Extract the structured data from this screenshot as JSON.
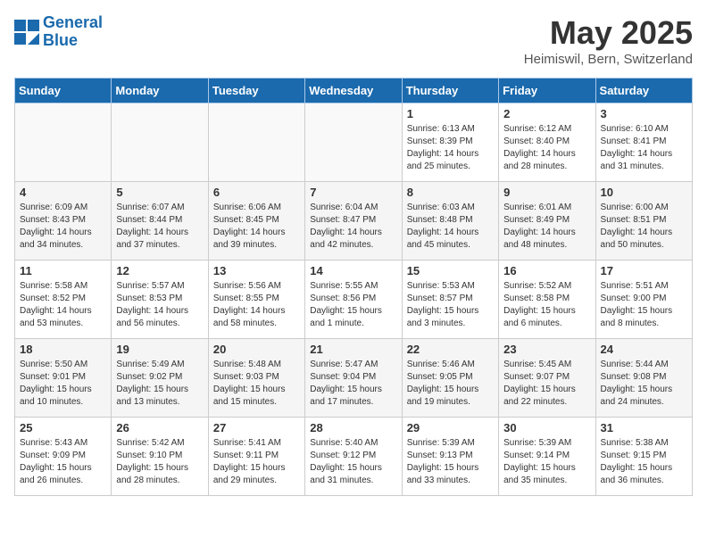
{
  "header": {
    "logo_line1": "General",
    "logo_line2": "Blue",
    "month_year": "May 2025",
    "location": "Heimiswil, Bern, Switzerland"
  },
  "weekdays": [
    "Sunday",
    "Monday",
    "Tuesday",
    "Wednesday",
    "Thursday",
    "Friday",
    "Saturday"
  ],
  "weeks": [
    [
      {
        "day": "",
        "info": ""
      },
      {
        "day": "",
        "info": ""
      },
      {
        "day": "",
        "info": ""
      },
      {
        "day": "",
        "info": ""
      },
      {
        "day": "1",
        "info": "Sunrise: 6:13 AM\nSunset: 8:39 PM\nDaylight: 14 hours\nand 25 minutes."
      },
      {
        "day": "2",
        "info": "Sunrise: 6:12 AM\nSunset: 8:40 PM\nDaylight: 14 hours\nand 28 minutes."
      },
      {
        "day": "3",
        "info": "Sunrise: 6:10 AM\nSunset: 8:41 PM\nDaylight: 14 hours\nand 31 minutes."
      }
    ],
    [
      {
        "day": "4",
        "info": "Sunrise: 6:09 AM\nSunset: 8:43 PM\nDaylight: 14 hours\nand 34 minutes."
      },
      {
        "day": "5",
        "info": "Sunrise: 6:07 AM\nSunset: 8:44 PM\nDaylight: 14 hours\nand 37 minutes."
      },
      {
        "day": "6",
        "info": "Sunrise: 6:06 AM\nSunset: 8:45 PM\nDaylight: 14 hours\nand 39 minutes."
      },
      {
        "day": "7",
        "info": "Sunrise: 6:04 AM\nSunset: 8:47 PM\nDaylight: 14 hours\nand 42 minutes."
      },
      {
        "day": "8",
        "info": "Sunrise: 6:03 AM\nSunset: 8:48 PM\nDaylight: 14 hours\nand 45 minutes."
      },
      {
        "day": "9",
        "info": "Sunrise: 6:01 AM\nSunset: 8:49 PM\nDaylight: 14 hours\nand 48 minutes."
      },
      {
        "day": "10",
        "info": "Sunrise: 6:00 AM\nSunset: 8:51 PM\nDaylight: 14 hours\nand 50 minutes."
      }
    ],
    [
      {
        "day": "11",
        "info": "Sunrise: 5:58 AM\nSunset: 8:52 PM\nDaylight: 14 hours\nand 53 minutes."
      },
      {
        "day": "12",
        "info": "Sunrise: 5:57 AM\nSunset: 8:53 PM\nDaylight: 14 hours\nand 56 minutes."
      },
      {
        "day": "13",
        "info": "Sunrise: 5:56 AM\nSunset: 8:55 PM\nDaylight: 14 hours\nand 58 minutes."
      },
      {
        "day": "14",
        "info": "Sunrise: 5:55 AM\nSunset: 8:56 PM\nDaylight: 15 hours\nand 1 minute."
      },
      {
        "day": "15",
        "info": "Sunrise: 5:53 AM\nSunset: 8:57 PM\nDaylight: 15 hours\nand 3 minutes."
      },
      {
        "day": "16",
        "info": "Sunrise: 5:52 AM\nSunset: 8:58 PM\nDaylight: 15 hours\nand 6 minutes."
      },
      {
        "day": "17",
        "info": "Sunrise: 5:51 AM\nSunset: 9:00 PM\nDaylight: 15 hours\nand 8 minutes."
      }
    ],
    [
      {
        "day": "18",
        "info": "Sunrise: 5:50 AM\nSunset: 9:01 PM\nDaylight: 15 hours\nand 10 minutes."
      },
      {
        "day": "19",
        "info": "Sunrise: 5:49 AM\nSunset: 9:02 PM\nDaylight: 15 hours\nand 13 minutes."
      },
      {
        "day": "20",
        "info": "Sunrise: 5:48 AM\nSunset: 9:03 PM\nDaylight: 15 hours\nand 15 minutes."
      },
      {
        "day": "21",
        "info": "Sunrise: 5:47 AM\nSunset: 9:04 PM\nDaylight: 15 hours\nand 17 minutes."
      },
      {
        "day": "22",
        "info": "Sunrise: 5:46 AM\nSunset: 9:05 PM\nDaylight: 15 hours\nand 19 minutes."
      },
      {
        "day": "23",
        "info": "Sunrise: 5:45 AM\nSunset: 9:07 PM\nDaylight: 15 hours\nand 22 minutes."
      },
      {
        "day": "24",
        "info": "Sunrise: 5:44 AM\nSunset: 9:08 PM\nDaylight: 15 hours\nand 24 minutes."
      }
    ],
    [
      {
        "day": "25",
        "info": "Sunrise: 5:43 AM\nSunset: 9:09 PM\nDaylight: 15 hours\nand 26 minutes."
      },
      {
        "day": "26",
        "info": "Sunrise: 5:42 AM\nSunset: 9:10 PM\nDaylight: 15 hours\nand 28 minutes."
      },
      {
        "day": "27",
        "info": "Sunrise: 5:41 AM\nSunset: 9:11 PM\nDaylight: 15 hours\nand 29 minutes."
      },
      {
        "day": "28",
        "info": "Sunrise: 5:40 AM\nSunset: 9:12 PM\nDaylight: 15 hours\nand 31 minutes."
      },
      {
        "day": "29",
        "info": "Sunrise: 5:39 AM\nSunset: 9:13 PM\nDaylight: 15 hours\nand 33 minutes."
      },
      {
        "day": "30",
        "info": "Sunrise: 5:39 AM\nSunset: 9:14 PM\nDaylight: 15 hours\nand 35 minutes."
      },
      {
        "day": "31",
        "info": "Sunrise: 5:38 AM\nSunset: 9:15 PM\nDaylight: 15 hours\nand 36 minutes."
      }
    ]
  ]
}
